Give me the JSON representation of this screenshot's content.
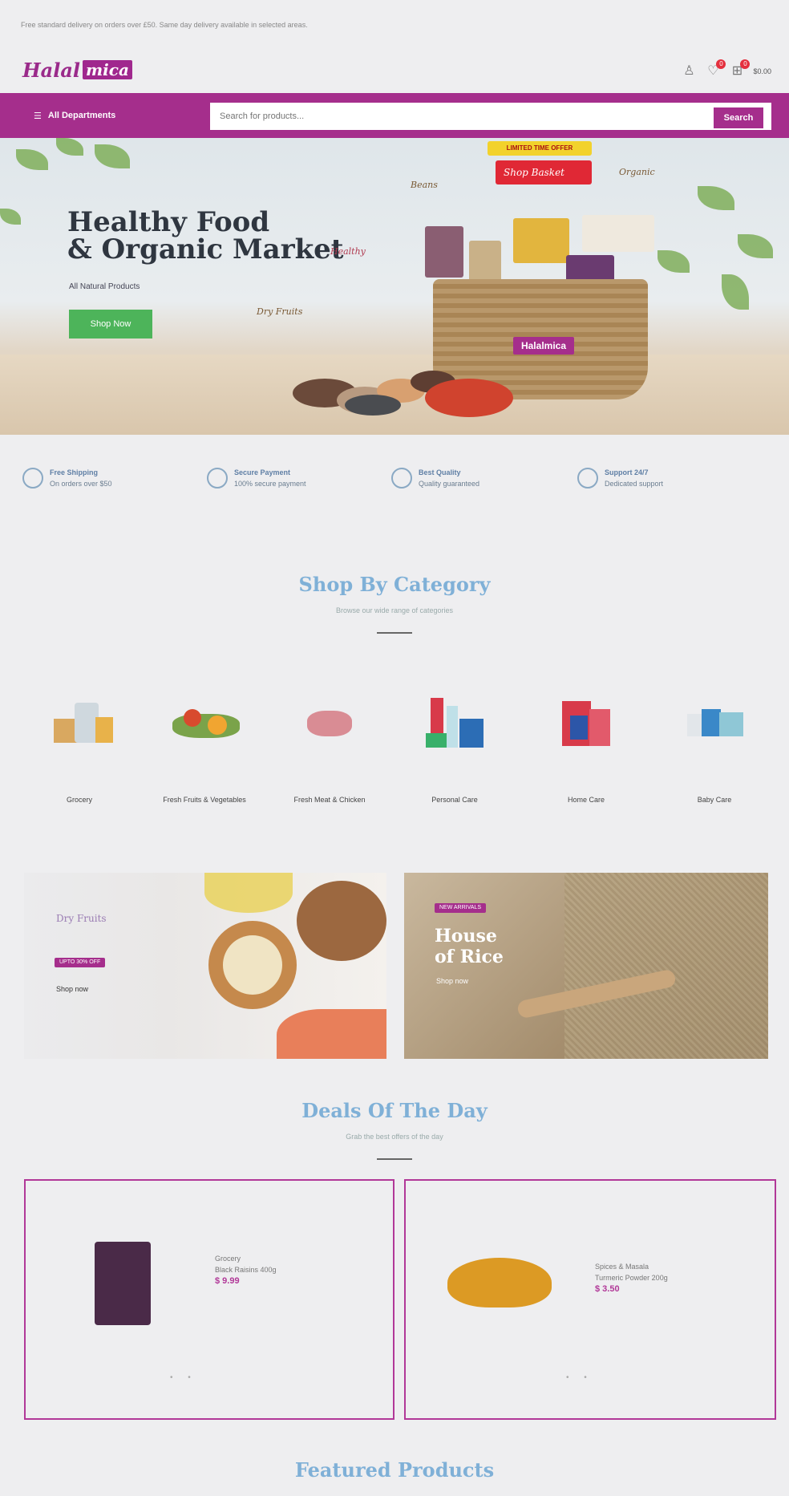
{
  "topbar": {
    "notice": "Free standard delivery on orders over £50. Same day delivery available in selected areas."
  },
  "header": {
    "logo_word1": "Halal",
    "logo_word2": "mica",
    "icons": [
      {
        "name": "user-icon",
        "glyph": "♙",
        "badge": ""
      },
      {
        "name": "wishlist-icon",
        "glyph": "♡",
        "badge": "0"
      },
      {
        "name": "cart-icon",
        "glyph": "🛒",
        "badge": "0"
      }
    ],
    "cart_total": "$0.00"
  },
  "search": {
    "categories_label": "All Departments",
    "placeholder": "Search for products...",
    "submit_label": "Search"
  },
  "hero": {
    "title_line1": "Healthy Food",
    "title_line2": "& Organic Market",
    "script_tag": "Healthy",
    "subtitle": "All Natural Products",
    "button_label": "Shop Now",
    "tag_dry_fruits": "Dry Fruits",
    "tag_beans": "Beans",
    "tag_organic": "Organic",
    "promo_badge": "LIMITED TIME OFFER",
    "promo_text": "Shop Basket",
    "basket_label": "Halalmica"
  },
  "features": [
    {
      "title": "Free Shipping",
      "text": "On orders over $50"
    },
    {
      "title": "Secure Payment",
      "text": "100% secure payment"
    },
    {
      "title": "Best Quality",
      "text": "Quality guaranteed"
    },
    {
      "title": "Support 24/7",
      "text": "Dedicated support"
    }
  ],
  "shop_by_category": {
    "title": "Shop By Category",
    "subtitle": "Browse our wide range of categories",
    "items": [
      {
        "label": "Grocery"
      },
      {
        "label": "Fresh Fruits & Vegetables"
      },
      {
        "label": "Fresh Meat & Chicken"
      },
      {
        "label": "Personal Care"
      },
      {
        "label": "Home Care"
      },
      {
        "label": "Baby Care"
      }
    ]
  },
  "banners": {
    "left": {
      "heading": "Dry Fruits",
      "pill": "UPTO 30% OFF",
      "link": "Shop now"
    },
    "right": {
      "pill": "NEW ARRIVALS",
      "title_line1": "House",
      "title_line2": "of Rice",
      "link": "Shop now"
    }
  },
  "deals": {
    "title": "Deals Of The Day",
    "subtitle": "Grab the best offers of the day",
    "items": [
      {
        "category": "Grocery",
        "name": "Black Raisins 400g",
        "price": "$ 9.99"
      },
      {
        "category": "Spices & Masala",
        "name": "Turmeric Powder 200g",
        "price": "$ 3.50"
      }
    ]
  },
  "featured": {
    "title": "Featured Products"
  },
  "colors": {
    "brand": "#a52e8c",
    "section_title": "#7fb0d7",
    "cta_green": "#4db45a"
  }
}
